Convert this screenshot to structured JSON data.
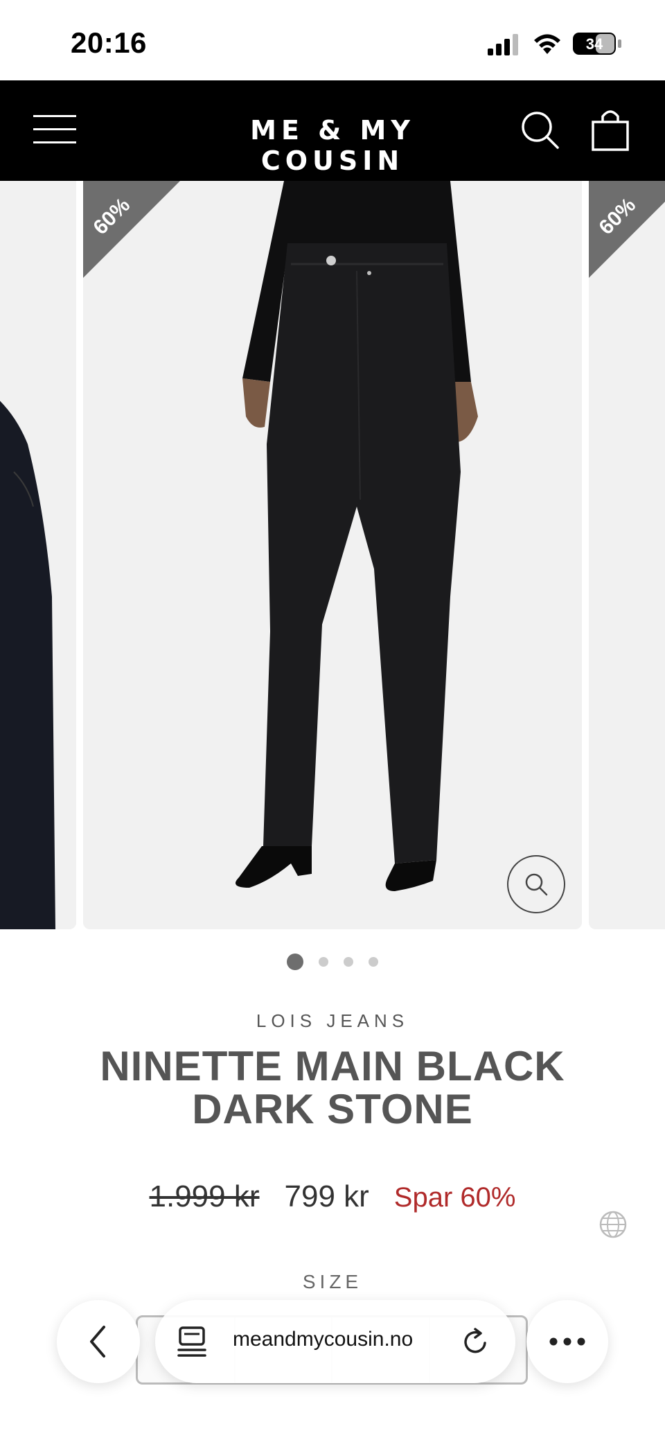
{
  "status_bar": {
    "time": "20:16",
    "battery": "34"
  },
  "header": {
    "brand": "ME & MY COUSIN",
    "menu_icon": "menu-icon",
    "search_icon": "search-icon",
    "bag_icon": "shopping-bag-icon"
  },
  "gallery": {
    "discount_badge": "60%",
    "slide_count": 4,
    "active_slide": 1
  },
  "product": {
    "brand": "LOIS JEANS",
    "title_line1": "NINETTE MAIN BLACK",
    "title_line2": "DARK STONE",
    "price_old": "1.999 kr",
    "price_new": "799 kr",
    "savings": "Spar 60%",
    "size_label": "SIZE"
  },
  "browser": {
    "url": "meandmycousin.no"
  },
  "colors": {
    "header_bg": "#000000",
    "savings": "#b02a2a",
    "ribbon": "#6e6e6e"
  }
}
